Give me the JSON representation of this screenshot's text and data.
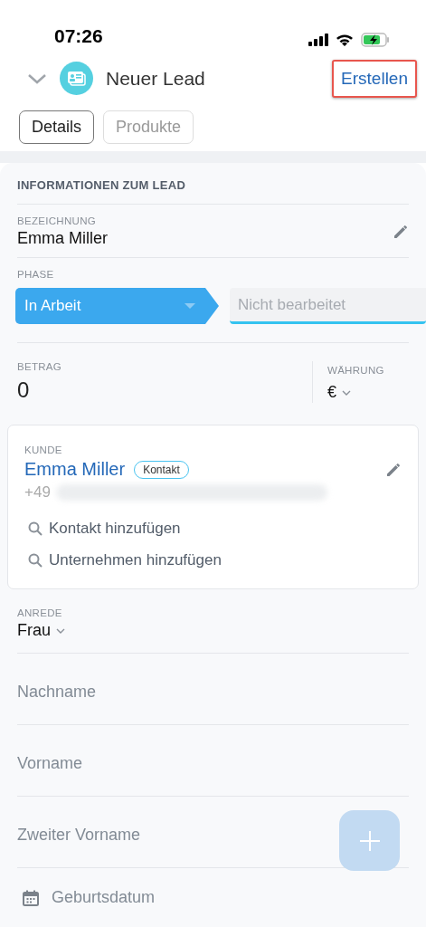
{
  "status_bar": {
    "time": "07:26"
  },
  "header": {
    "title": "Neuer Lead",
    "action": "Erstellen",
    "action_highlighted": true
  },
  "tabs": [
    {
      "label": "Details",
      "selected": true
    },
    {
      "label": "Produkte",
      "selected": false
    }
  ],
  "section": {
    "title": "INFORMATIONEN ZUM LEAD"
  },
  "name_field": {
    "label": "BEZEICHNUNG",
    "value": "Emma Miller"
  },
  "phase": {
    "label": "PHASE",
    "stages": [
      {
        "label": "In Arbeit",
        "selected": true
      },
      {
        "label": "Nicht bearbeitet",
        "selected": false
      }
    ]
  },
  "amount": {
    "label": "BETRAG",
    "value": "0"
  },
  "currency": {
    "label": "WÄHRUNG",
    "value": "€"
  },
  "customer": {
    "label": "KUNDE",
    "name": "Emma Miller",
    "badge": "Kontakt",
    "phone_prefix": "+49",
    "actions": [
      "Kontakt hinzufügen",
      "Unternehmen hinzufügen"
    ]
  },
  "salutation": {
    "label": "ANREDE",
    "value": "Frau"
  },
  "fields": [
    {
      "kind": "text",
      "placeholder": "Nachname"
    },
    {
      "kind": "text",
      "placeholder": "Vorname"
    },
    {
      "kind": "text",
      "placeholder": "Zweiter Vorname"
    },
    {
      "kind": "date",
      "placeholder": "Geburtsdatum"
    }
  ]
}
